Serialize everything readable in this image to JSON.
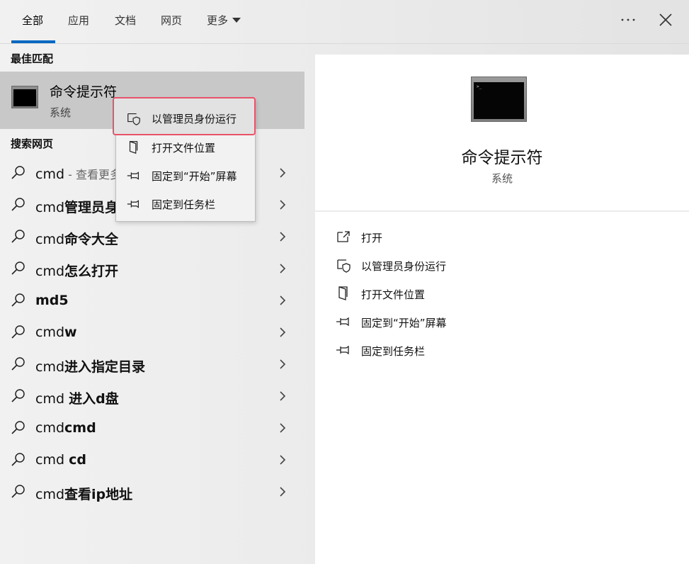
{
  "tabs": [
    {
      "label": "全部",
      "active": true
    },
    {
      "label": "应用"
    },
    {
      "label": "文档"
    },
    {
      "label": "网页"
    },
    {
      "label": "更多"
    }
  ],
  "best_match": {
    "section_title": "最佳匹配",
    "title": "命令提示符",
    "subtitle": "系统"
  },
  "web_search": {
    "section_title": "搜索网页",
    "items": [
      {
        "prefix": "cmd",
        "bold": "",
        "suffix": " - 查看更多"
      },
      {
        "prefix": "cmd",
        "bold": "管理员身",
        "suffix": ""
      },
      {
        "prefix": "cmd",
        "bold": "命令大全",
        "suffix": ""
      },
      {
        "prefix": "cmd",
        "bold": "怎么打开",
        "suffix": ""
      },
      {
        "prefix": "",
        "bold": "md5",
        "suffix": ""
      },
      {
        "prefix": "cmd",
        "bold": "w",
        "suffix": ""
      },
      {
        "prefix": "cmd",
        "bold": "进入指定目录",
        "suffix": ""
      },
      {
        "prefix": "cmd ",
        "bold": "进入d盘",
        "suffix": ""
      },
      {
        "prefix": "cmd",
        "bold": "cmd",
        "suffix": ""
      },
      {
        "prefix": "cmd ",
        "bold": "cd",
        "suffix": ""
      },
      {
        "prefix": "cmd",
        "bold": "查看ip地址",
        "suffix": ""
      }
    ]
  },
  "context_menu": {
    "items": [
      {
        "label": "以管理员身份运行",
        "icon": "shield-icon"
      },
      {
        "label": "打开文件位置",
        "icon": "folder-open-icon"
      },
      {
        "label": "固定到“开始”屏幕",
        "icon": "pin-icon"
      },
      {
        "label": "固定到任务栏",
        "icon": "pin-icon"
      }
    ]
  },
  "detail": {
    "title": "命令提示符",
    "subtitle": "系统",
    "actions": [
      {
        "label": "打开",
        "icon": "open-icon"
      },
      {
        "label": "以管理员身份运行",
        "icon": "shield-icon"
      },
      {
        "label": "打开文件位置",
        "icon": "folder-open-icon"
      },
      {
        "label": "固定到“开始”屏幕",
        "icon": "pin-icon"
      },
      {
        "label": "固定到任务栏",
        "icon": "pin-icon"
      }
    ]
  },
  "colors": {
    "accent": "#0067c0",
    "highlight_border": "#e8546a",
    "selected_bg": "#c8c8c8"
  }
}
